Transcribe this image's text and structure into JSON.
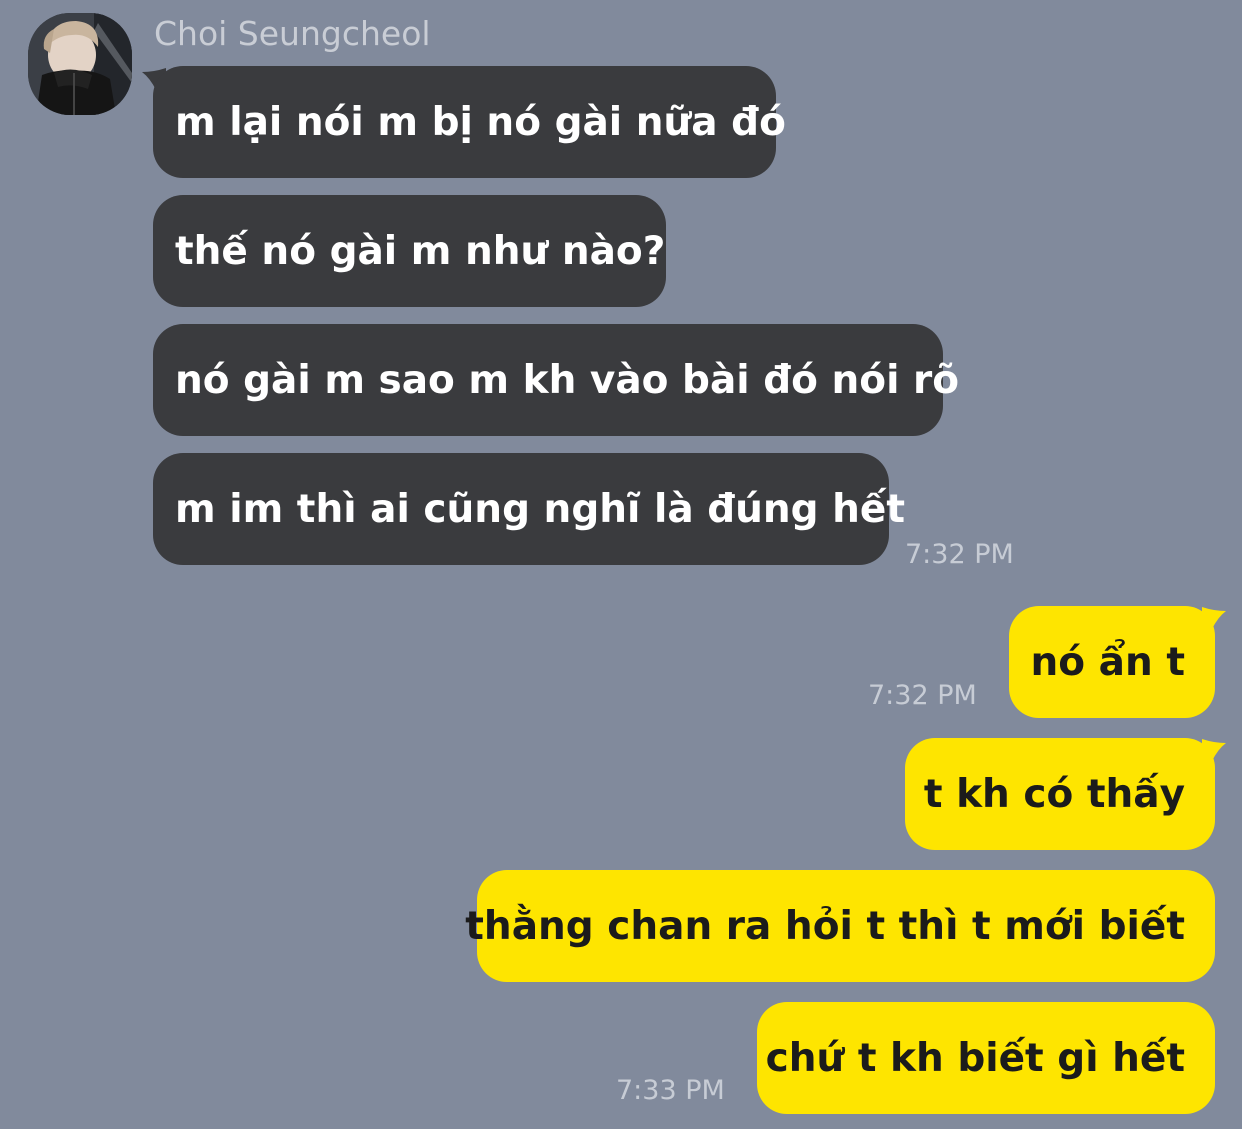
{
  "chat": {
    "sender": {
      "name": "Choi Seungcheol",
      "avatar": "profile-photo"
    },
    "incoming": [
      {
        "text": "m lại nói m bị nó gài nữa đó"
      },
      {
        "text": "thế nó gài m như nào?"
      },
      {
        "text": "nó gài m sao m kh vào bài đó nói rõ"
      },
      {
        "text": "m im thì ai cũng nghĩ là đúng hết"
      }
    ],
    "incoming_time": "7:32 PM",
    "outgoing": [
      {
        "text": "nó ẩn t",
        "time": "7:32 PM"
      },
      {
        "text": "t kh có thấy"
      },
      {
        "text": "thằng chan ra hỏi t thì t mới biết"
      },
      {
        "text": "chứ t kh biết gì hết",
        "time": "7:33 PM"
      }
    ]
  },
  "colors": {
    "background": "#818a9c",
    "incoming_bubble": "#3a3b3e",
    "outgoing_bubble": "#fee500",
    "incoming_text": "#ffffff",
    "outgoing_text": "#1b1b1b",
    "timestamp": "#c7ccd5"
  }
}
